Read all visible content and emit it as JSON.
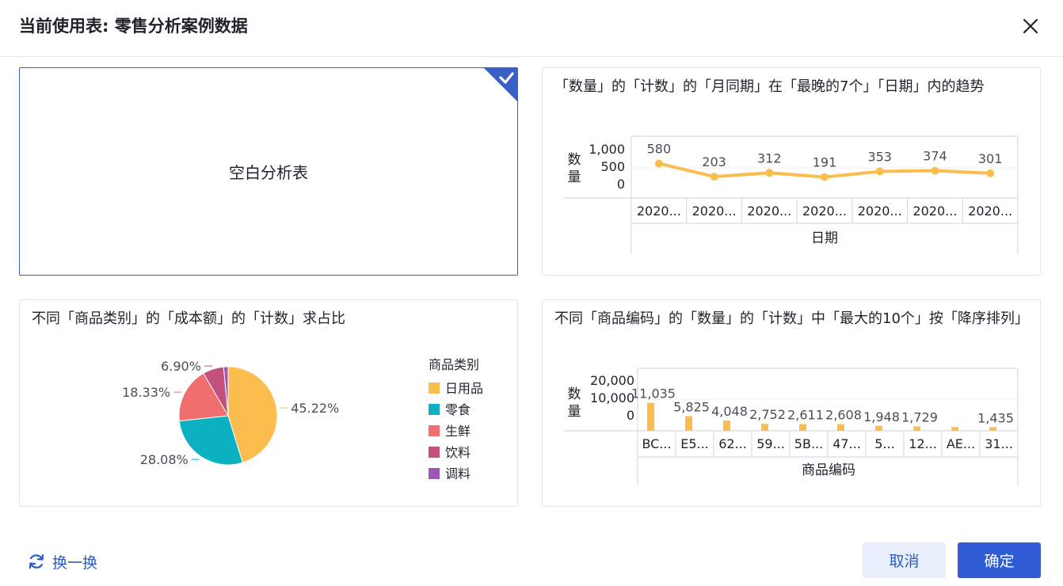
{
  "dialog": {
    "title": "当前使用表: 零售分析案例数据",
    "close_icon": "close-icon"
  },
  "cards": {
    "blank": {
      "label": "空白分析表",
      "selected": true,
      "check_icon": "check-icon"
    },
    "line": {
      "title": "「数量」的「计数」的「月同期」在「最晚的7个」「日期」内的趋势",
      "chart_data": {
        "type": "line",
        "categories": [
          "2020...",
          "2020...",
          "2020...",
          "2020...",
          "2020...",
          "2020...",
          "2020..."
        ],
        "values": [
          580,
          203,
          312,
          191,
          353,
          374,
          301
        ],
        "data_labels": [
          "580",
          "203",
          "312",
          "191",
          "353",
          "374",
          "301"
        ],
        "ylabel": "数量",
        "xlabel": "日期",
        "yticks": [
          "1,000",
          "500",
          "0"
        ],
        "ylim": [
          0,
          1000
        ],
        "color": "#fbbd4e",
        "grid": true
      }
    },
    "pie": {
      "title": "不同「商品类别」的「成本额」的「计数」求占比",
      "chart_data": {
        "type": "pie",
        "legend_title": "商品类别",
        "legend_position": "right",
        "slices": [
          {
            "label": "日用品",
            "value": 45.22,
            "text": "45.22%",
            "color": "#fbbd4e"
          },
          {
            "label": "零食",
            "value": 28.08,
            "text": "28.08%",
            "color": "#0cb1c1"
          },
          {
            "label": "生鲜",
            "value": 18.33,
            "text": "18.33%",
            "color": "#f06e6e"
          },
          {
            "label": "饮料",
            "value": 6.9,
            "text": "6.90%",
            "color": "#c4507e"
          },
          {
            "label": "调料",
            "value": 1.47,
            "text": "",
            "color": "#9b59b6"
          }
        ]
      }
    },
    "bar": {
      "title": "不同「商品编码」的「数量」的「计数」中「最大的10个」按「降序排列」",
      "chart_data": {
        "type": "bar",
        "categories": [
          "BC...",
          "E5...",
          "62...",
          "59...",
          "5B...",
          "47...",
          "5...",
          "12...",
          "AE...",
          "31..."
        ],
        "values": [
          11035,
          5825,
          4048,
          2752,
          2611,
          2608,
          1948,
          1729,
          1500,
          1435
        ],
        "data_labels": [
          "11,035",
          "5,825",
          "4,048",
          "2,752",
          "2,611",
          "2,608",
          "1,948",
          "1,729",
          "",
          "1,435"
        ],
        "ylabel": "数量",
        "xlabel": "商品编码",
        "yticks": [
          "20,000",
          "10,000",
          "0"
        ],
        "ylim": [
          0,
          20000
        ],
        "color": "#fbbd4e",
        "grid": true
      }
    }
  },
  "footer": {
    "refresh_label": "换一换",
    "refresh_icon": "refresh-icon",
    "cancel_label": "取消",
    "ok_label": "确定",
    "accent": "#2f5bd4"
  }
}
